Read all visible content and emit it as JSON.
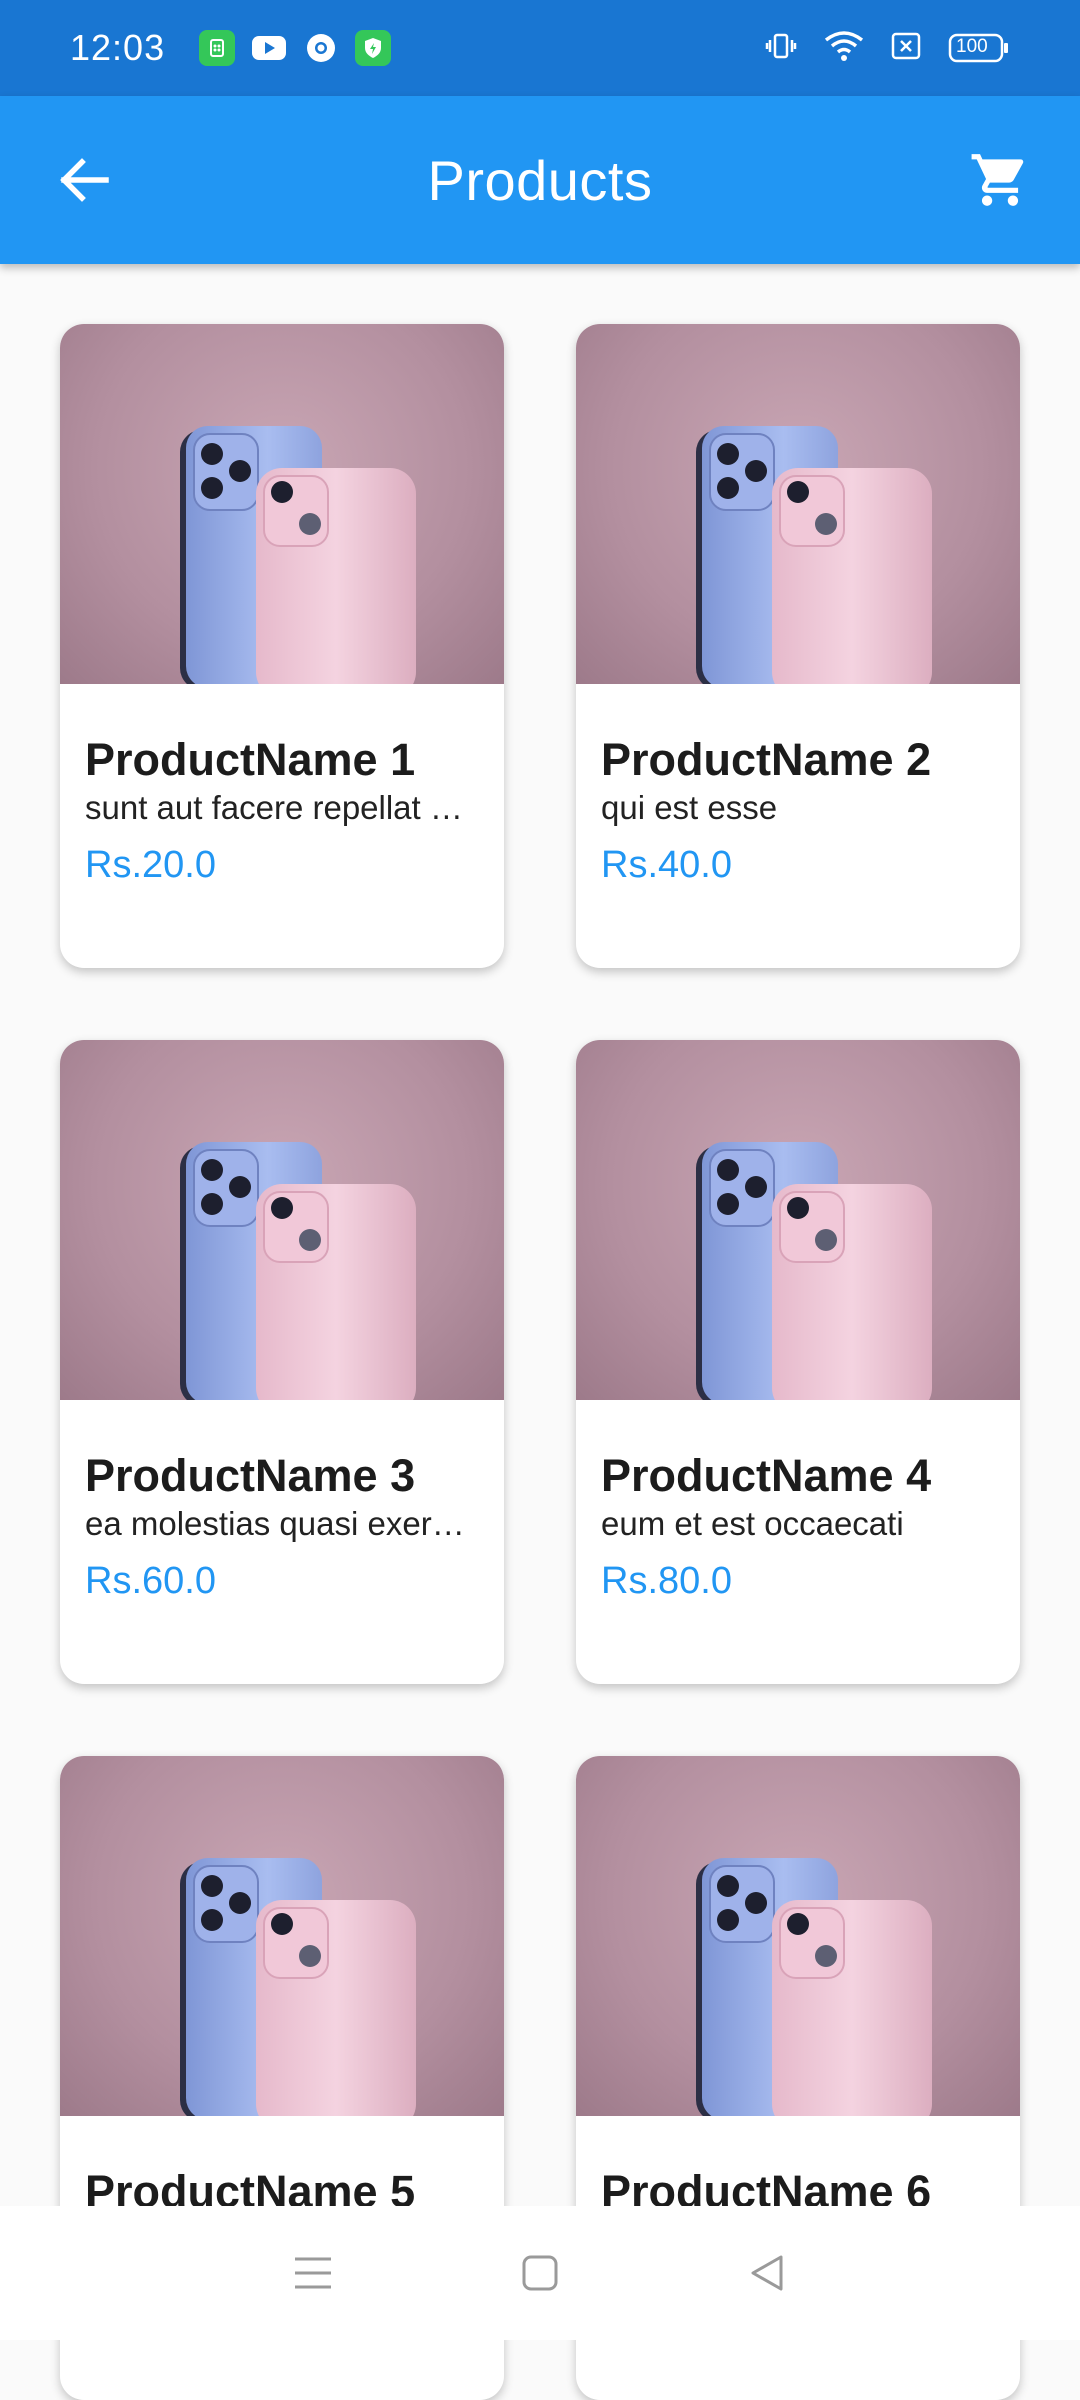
{
  "status_bar": {
    "time": "12:03",
    "battery": "100"
  },
  "app_bar": {
    "title": "Products",
    "back_icon": "arrow-back-icon",
    "cart_icon": "shopping-cart-icon"
  },
  "colors": {
    "primary": "#2196f3",
    "status_bar": "#1976d2",
    "price": "#2196f3"
  },
  "products": [
    {
      "name": "ProductName 1",
      "description": "sunt aut facere repellat provident occaecati excepturi optio reprehenderit",
      "price": "Rs.20.0"
    },
    {
      "name": "ProductName 2",
      "description": "qui est esse",
      "price": "Rs.40.0"
    },
    {
      "name": "ProductName 3",
      "description": "ea molestias quasi exercitationem repellat qui ipsa sit aut",
      "price": "Rs.60.0"
    },
    {
      "name": "ProductName 4",
      "description": "eum et est occaecati",
      "price": "Rs.80.0"
    },
    {
      "name": "ProductName 5",
      "description": "",
      "price": ""
    },
    {
      "name": "ProductName 6",
      "description": "",
      "price": ""
    }
  ]
}
